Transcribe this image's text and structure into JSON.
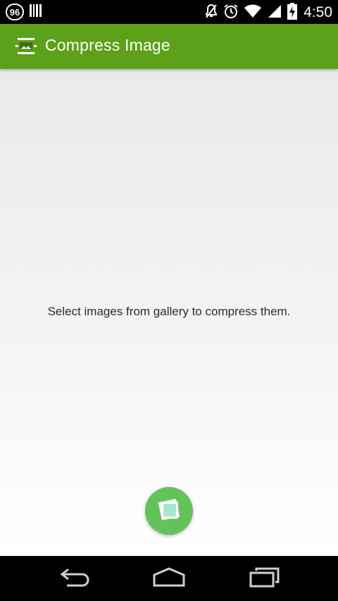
{
  "status_bar": {
    "notification_badge": "96",
    "time": "4:50",
    "icons": [
      "notification-badge-icon",
      "barcode-icon",
      "mute-icon",
      "alarm-icon",
      "wifi-icon",
      "signal-icon",
      "battery-charging-icon"
    ]
  },
  "app_bar": {
    "title": "Compress Image",
    "icon": "image-compress-icon",
    "color": "#5da019"
  },
  "main": {
    "empty_message": "Select images from gallery to compress them.",
    "fab": {
      "icon": "gallery-photos-icon",
      "color": "#64c25a"
    }
  },
  "nav_bar": {
    "buttons": [
      "back-icon",
      "home-icon",
      "recent-apps-icon"
    ]
  }
}
